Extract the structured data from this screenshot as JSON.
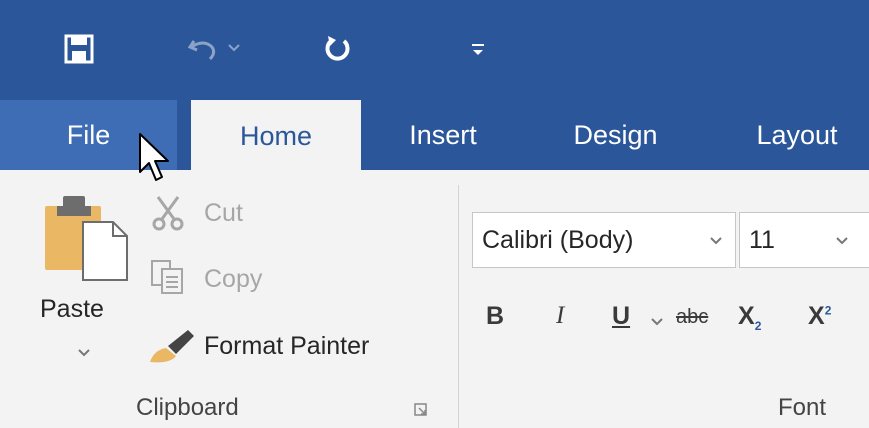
{
  "quick_access": {
    "save_icon": "save-icon",
    "undo_icon": "undo-icon",
    "undo_dropdown_icon": "chevron-down-icon",
    "redo_icon": "repeat-icon",
    "customize_icon": "customize-qat-icon"
  },
  "tabs": [
    {
      "label": "File"
    },
    {
      "label": "Home"
    },
    {
      "label": "Insert"
    },
    {
      "label": "Design"
    },
    {
      "label": "Layout"
    }
  ],
  "clipboard": {
    "paste_label": "Paste",
    "cut_label": "Cut",
    "copy_label": "Copy",
    "format_painter_label": "Format Painter",
    "group_label": "Clipboard"
  },
  "font": {
    "font_name": "Calibri (Body)",
    "font_size": "11",
    "bold": "B",
    "italic": "I",
    "underline": "U",
    "strikethrough": "abc",
    "subscript": "X",
    "superscript": "X",
    "group_label": "Font"
  },
  "colors": {
    "title_bar": "#2b579a",
    "file_tab_hover": "#3e6db5",
    "ribbon_bg": "#f3f3f3"
  }
}
